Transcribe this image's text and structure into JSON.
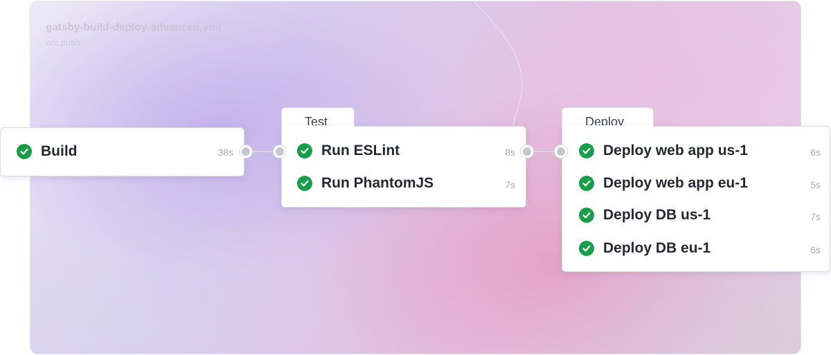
{
  "workflow": {
    "file_name": "gatsby-build-deploy-advanced.yml",
    "trigger": "on: push"
  },
  "stages": [
    {
      "name": "",
      "jobs": [
        {
          "name": "Build",
          "duration": "38s",
          "status": "success"
        }
      ]
    },
    {
      "name": "Test",
      "jobs": [
        {
          "name": "Run ESLint",
          "duration": "8s",
          "status": "success"
        },
        {
          "name": "Run PhantomJS",
          "duration": "7s",
          "status": "success"
        }
      ]
    },
    {
      "name": "Deploy",
      "jobs": [
        {
          "name": "Deploy web app us-1",
          "duration": "6s",
          "status": "success"
        },
        {
          "name": "Deploy web app eu-1",
          "duration": "5s",
          "status": "success"
        },
        {
          "name": "Deploy DB us-1",
          "duration": "7s",
          "status": "success"
        },
        {
          "name": "Deploy DB eu-1",
          "duration": "6s",
          "status": "success"
        }
      ]
    }
  ],
  "icons": {
    "status_success": "check-circle-icon"
  },
  "colors": {
    "success": "#1a9d48",
    "job_text": "#25292f",
    "duration_text": "#a7abb3",
    "connector": "#d5d7de"
  }
}
